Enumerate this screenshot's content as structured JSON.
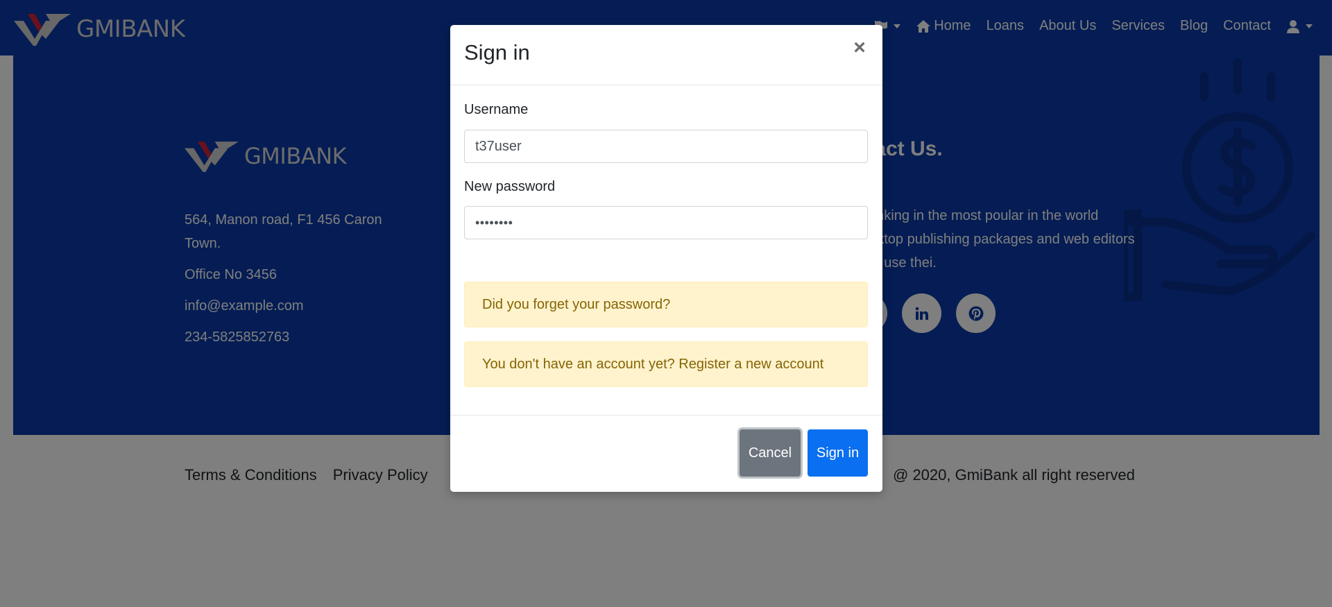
{
  "brand": {
    "name": "GMIBANK",
    "accent": "#d62336",
    "logo_gray": "#d8d8d8"
  },
  "nav": {
    "items": [
      {
        "label": "Home"
      },
      {
        "label": "Loans"
      },
      {
        "label": "About Us"
      },
      {
        "label": "Services"
      },
      {
        "label": "Blog"
      },
      {
        "label": "Contact"
      }
    ]
  },
  "footer": {
    "address_line": "564, Manon road, F1 456 Caron Town.",
    "office": "Office No 3456",
    "email": "info@example.com",
    "phone": "234-5825852763",
    "contact_title": "ntact Us.",
    "contact_text": "-Banking in the most poular in the world desktop publishing packages and web editors now use thei.",
    "social_icons": [
      "twitter-icon",
      "linkedin-icon",
      "pinterest-icon"
    ],
    "links": [
      "Terms & Conditions",
      "Privacy Policy"
    ],
    "copyright": "@ 2020, GmiBank all right reserved"
  },
  "modal": {
    "title": "Sign in",
    "close_glyph": "×",
    "username_label": "Username",
    "username_value": "t37user",
    "password_label": "New password",
    "password_value": "••••••••",
    "forgot_text": "Did you forget your password?",
    "register_text": "You don't have an account yet? Register a new account",
    "cancel_label": "Cancel",
    "signin_label": "Sign in"
  },
  "colors": {
    "header_bg": "#0a3aa8",
    "primary_button": "#0a6ff0",
    "secondary_button": "#6c757d",
    "alert_bg": "#fff3cd",
    "alert_text": "#856404"
  }
}
